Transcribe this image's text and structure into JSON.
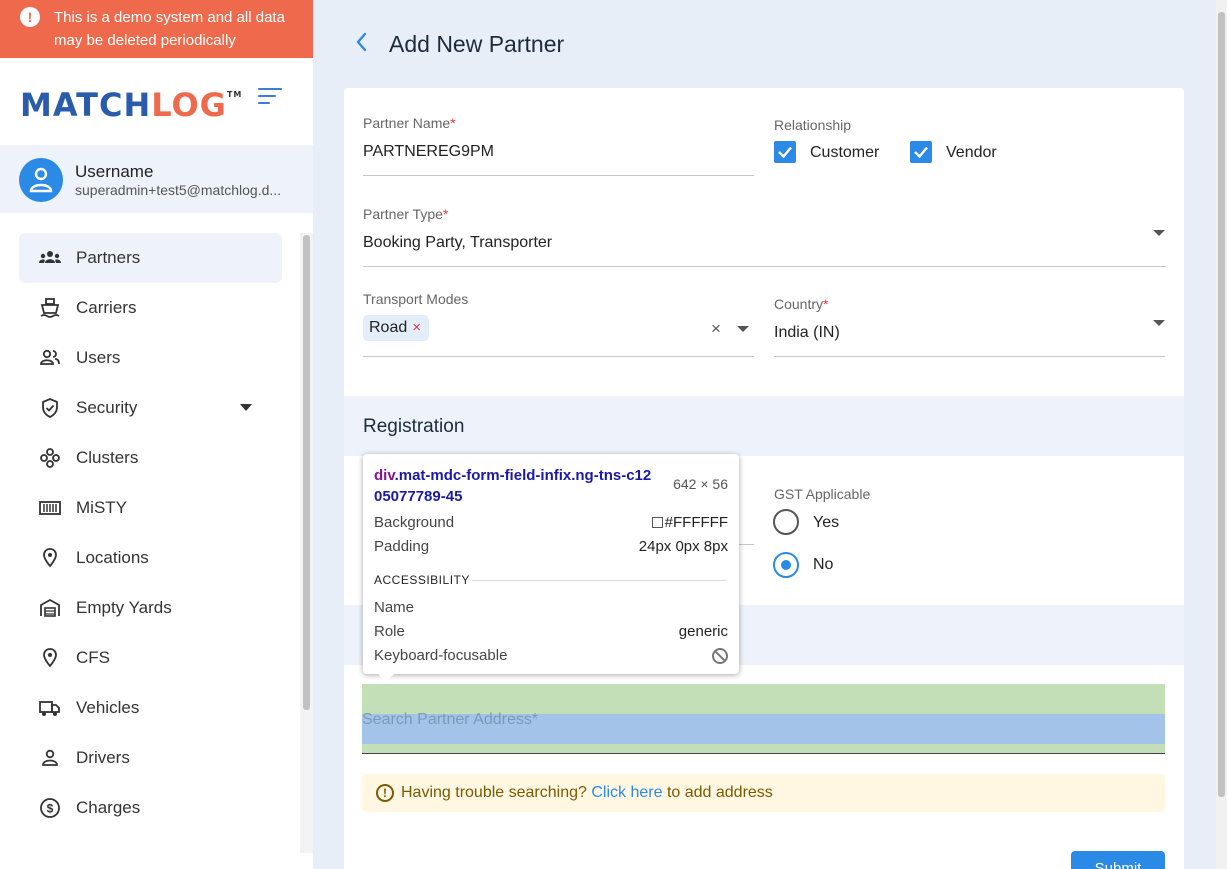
{
  "banner": {
    "text": "This is a demo system and all data may be deleted periodically",
    "icon": "exclamation-icon"
  },
  "brand": {
    "part1": "MATCH",
    "part2": "LOG",
    "tm": "TM"
  },
  "user": {
    "name": "Username",
    "email": "superadmin+test5@matchlog.d..."
  },
  "nav": {
    "items": [
      {
        "label": "Partners",
        "icon": "partners-icon"
      },
      {
        "label": "Carriers",
        "icon": "ship-icon"
      },
      {
        "label": "Users",
        "icon": "users-icon"
      },
      {
        "label": "Security",
        "icon": "shield-icon"
      },
      {
        "label": "Clusters",
        "icon": "clusters-icon"
      },
      {
        "label": "MiSTY",
        "icon": "container-icon"
      },
      {
        "label": "Locations",
        "icon": "location-pin-icon"
      },
      {
        "label": "Empty Yards",
        "icon": "warehouse-icon"
      },
      {
        "label": "CFS",
        "icon": "location-pin-icon"
      },
      {
        "label": "Vehicles",
        "icon": "truck-icon"
      },
      {
        "label": "Drivers",
        "icon": "driver-icon"
      },
      {
        "label": "Charges",
        "icon": "dollar-icon"
      }
    ]
  },
  "page": {
    "title": "Add New Partner"
  },
  "form": {
    "partner_name": {
      "label": "Partner Name",
      "required": "*",
      "value": "PARTNEREG9PM"
    },
    "relationship": {
      "label": "Relationship",
      "customer": "Customer",
      "vendor": "Vendor",
      "customer_checked": true,
      "vendor_checked": true
    },
    "partner_type": {
      "label": "Partner Type",
      "required": "*",
      "value": "Booking Party, Transporter"
    },
    "transport_modes": {
      "label": "Transport Modes",
      "chip": "Road",
      "chip_remove": "×",
      "clear": "×"
    },
    "country": {
      "label": "Country",
      "required": "*",
      "value": "India (IN)"
    },
    "registration": {
      "title": "Registration",
      "gst": {
        "label": "GST Applicable",
        "yes": "Yes",
        "no": "No",
        "selected": "No"
      }
    },
    "address": {
      "placeholder": "Search Partner Address*"
    },
    "help": {
      "prefix": "Having trouble searching?",
      "link": "Click here",
      "suffix": "to add address"
    },
    "submit_label": "Submit"
  },
  "devtools_tooltip": {
    "tag": "div",
    "classes": ".mat-mdc-form-field-infix.ng-tns-c1205077789-45",
    "size": "642 × 56",
    "background_label": "Background",
    "background_value": "#FFFFFF",
    "padding_label": "Padding",
    "padding_value": "24px 0px 8px",
    "accessibility_heading": "ACCESSIBILITY",
    "name_label": "Name",
    "role_label": "Role",
    "role_value": "generic",
    "focusable_label": "Keyboard-focusable"
  },
  "colors": {
    "brand_blue": "#2b5cab",
    "brand_orange": "#ef6a4c",
    "accent": "#2b8ae6",
    "banner": "#ef6a4c"
  }
}
